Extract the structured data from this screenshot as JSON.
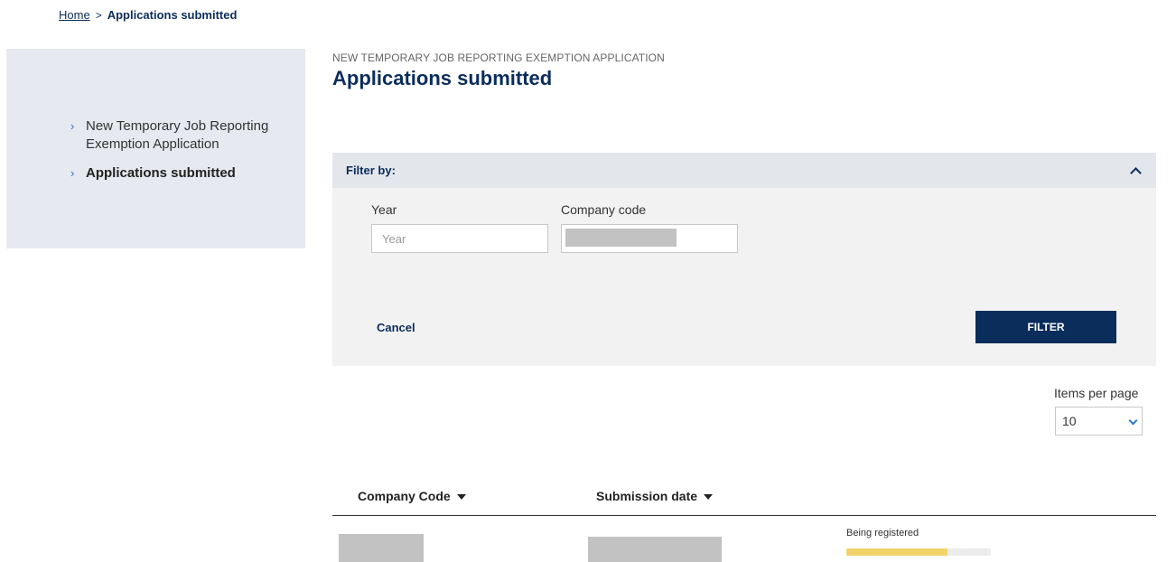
{
  "breadcrumb": {
    "home": "Home",
    "separator": ">",
    "current": "Applications submitted"
  },
  "sidebar": {
    "items": [
      {
        "label": "New Temporary Job Reporting Exemption Application",
        "active": false
      },
      {
        "label": "Applications submitted",
        "active": true
      }
    ]
  },
  "header": {
    "kicker": "NEW TEMPORARY JOB REPORTING EXEMPTION APPLICATION",
    "title": "Applications submitted"
  },
  "filter": {
    "heading": "Filter by:",
    "toggle_icon": "chevron-up-icon",
    "year_label": "Year",
    "year_placeholder": "Year",
    "year_value": "",
    "company_code_label": "Company code",
    "cancel_label": "Cancel",
    "filter_button_label": "FILTER"
  },
  "pagination": {
    "items_per_page_label": "Items per page",
    "items_per_page_value": "10"
  },
  "table": {
    "columns": [
      {
        "label": "Company Code",
        "sort_icon": "sort-down-icon"
      },
      {
        "label": "Submission date",
        "sort_icon": "sort-down-icon"
      }
    ],
    "rows": [
      {
        "status": "Being registered",
        "progress_fraction": 0.7
      }
    ]
  },
  "colors": {
    "brand_navy": "#0b2d5b",
    "accent_blue": "#2f77c9",
    "progress_yellow": "#f2d46a",
    "panel_gray": "#f2f2f2",
    "sidebar_gray": "#e6e9ef"
  }
}
